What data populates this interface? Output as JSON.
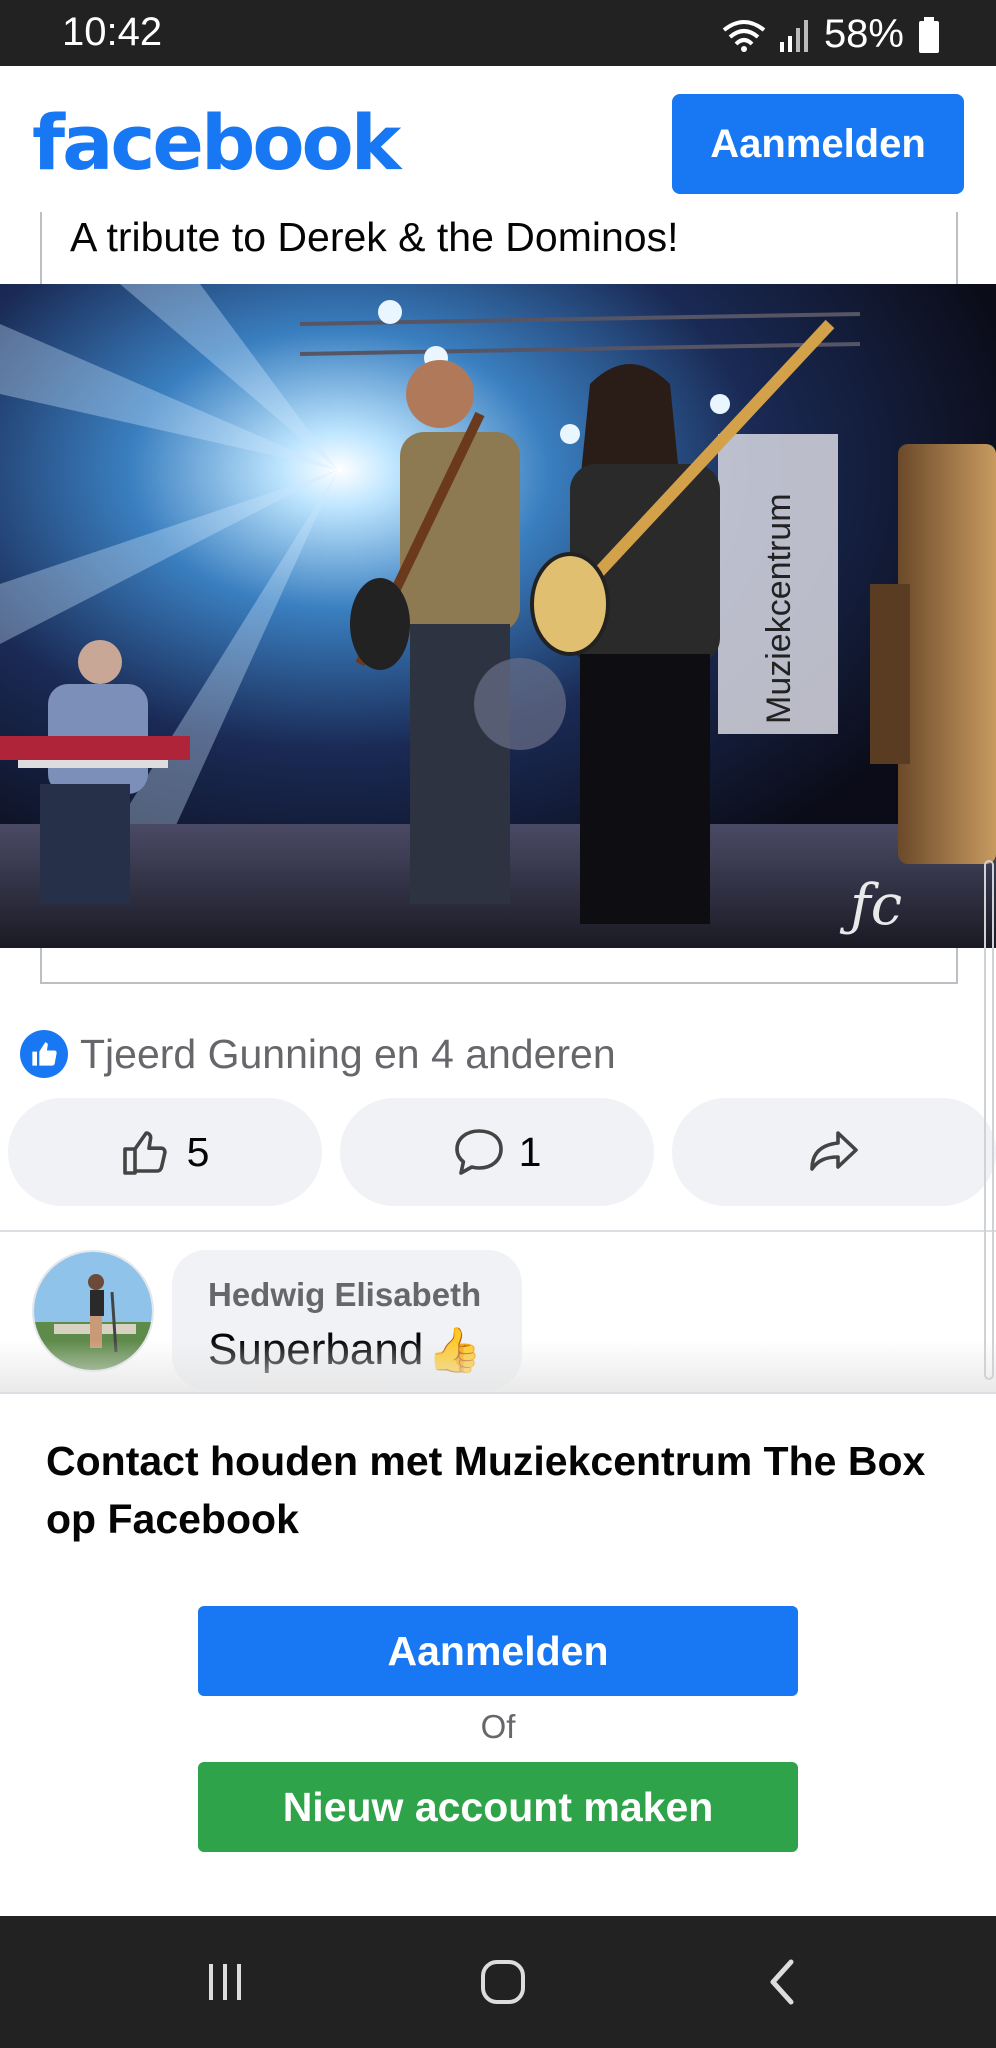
{
  "status_bar": {
    "time": "10:42",
    "battery": "58%",
    "icons": [
      "wifi-icon",
      "signal-icon",
      "battery-icon"
    ]
  },
  "header": {
    "logo": "facebook",
    "login_label": "Aanmelden"
  },
  "post": {
    "title": "A tribute to Derek & the Dominos!",
    "photo_banner_text": "Muziekcentrum",
    "photo_icon": "concert-photo"
  },
  "reactions": {
    "summary": "Tjeerd Gunning en 4 anderen",
    "icon": "like-badge-icon"
  },
  "actions": {
    "like_count": "5",
    "comment_count": "1",
    "icons": [
      "thumbs-up-icon",
      "comment-icon",
      "share-icon"
    ]
  },
  "comment": {
    "author": "Hedwig Elisabeth",
    "text": "Superband",
    "emoji": "👍"
  },
  "sheet": {
    "title": "Contact houden met Muziekcentrum The Box op Facebook",
    "login_label": "Aanmelden",
    "or_label": "Of",
    "create_label": "Nieuw account maken"
  },
  "nav": {
    "icons": [
      "recents-icon",
      "home-icon",
      "back-icon"
    ]
  },
  "colors": {
    "brand": "#1877f2",
    "create_green": "#2fa34a",
    "status_bar": "#222222"
  }
}
